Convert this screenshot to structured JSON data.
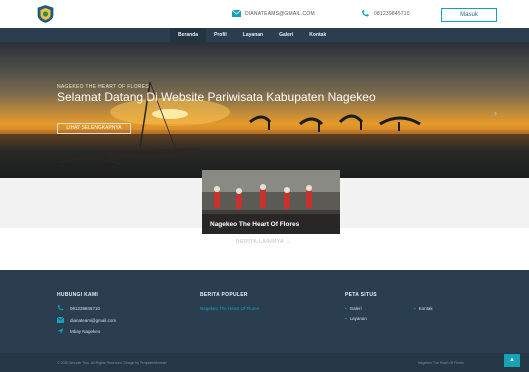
{
  "header": {
    "email": "DIANATEAMS@GMAIL.COM",
    "phone": "081239845710",
    "login_label": "Masuk"
  },
  "nav": {
    "items": [
      {
        "label": "Beranda",
        "active": true
      },
      {
        "label": "Profil",
        "active": false
      },
      {
        "label": "Layanan",
        "active": false
      },
      {
        "label": "Galeri",
        "active": false
      },
      {
        "label": "Kontak",
        "active": false
      }
    ]
  },
  "hero": {
    "subtitle": "NAGEKEO THE HEART OF FLORES",
    "title": "Selamat Datang Di Website Pariwisata Kabupaten Nagekeo",
    "button_label": "LIHAT SELENGKAPNYA",
    "next_arrow": "›"
  },
  "news": {
    "card_title": "Nagekeo The Heart Of Flores",
    "more_label": "BERITA LAINNYA",
    "more_arrow": "→"
  },
  "footer": {
    "contact_heading": "HUBUNGI KAMI",
    "contact_phone": "081239845710",
    "contact_email": "dianateam@gmail.com",
    "contact_location": "Mbay Nagekeo",
    "popular_heading": "BERITA POPULER",
    "popular_item": "Nagekeo The Heart Of Flores",
    "sitemap_heading": "PETA SITUS",
    "sitemap": {
      "galeri": "Galeri",
      "kontak": "Kontak",
      "layanan": "Layanan"
    },
    "copyright": "© 2020 Wonder Tour. All Rights Reserved. Design by TemplateMonster",
    "bottom_right": "Nagekeo The Heart Of Flores",
    "to_top_icon": "▲"
  },
  "colors": {
    "navbar": "#2b3e50",
    "accent": "#17a2b8",
    "footer": "#2b3e50"
  }
}
